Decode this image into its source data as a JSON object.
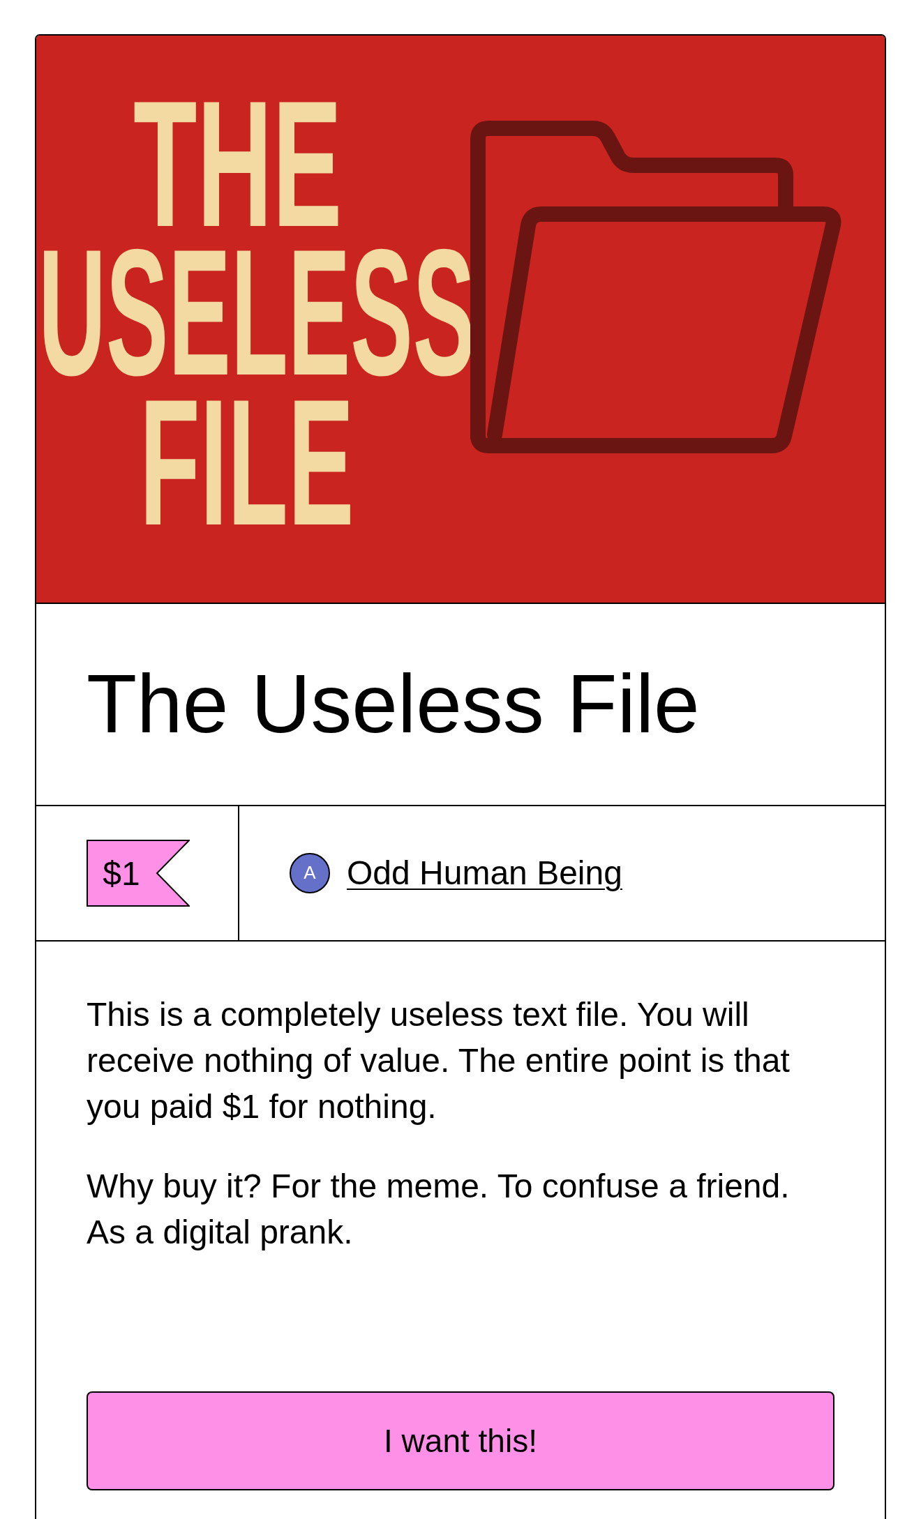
{
  "cover": {
    "headline": [
      "THE",
      "USELESS",
      "FILE"
    ]
  },
  "title": "The Useless File",
  "price": "$1",
  "creator": {
    "initial": "A",
    "name": "Odd Human Being"
  },
  "description": [
    "This is a completely useless text file. You will receive nothing of value. The entire point is that you paid $1 for nothing.",
    "Why buy it? For the meme. To confuse a friend. As a digital prank."
  ],
  "buy_button": "I want this!"
}
